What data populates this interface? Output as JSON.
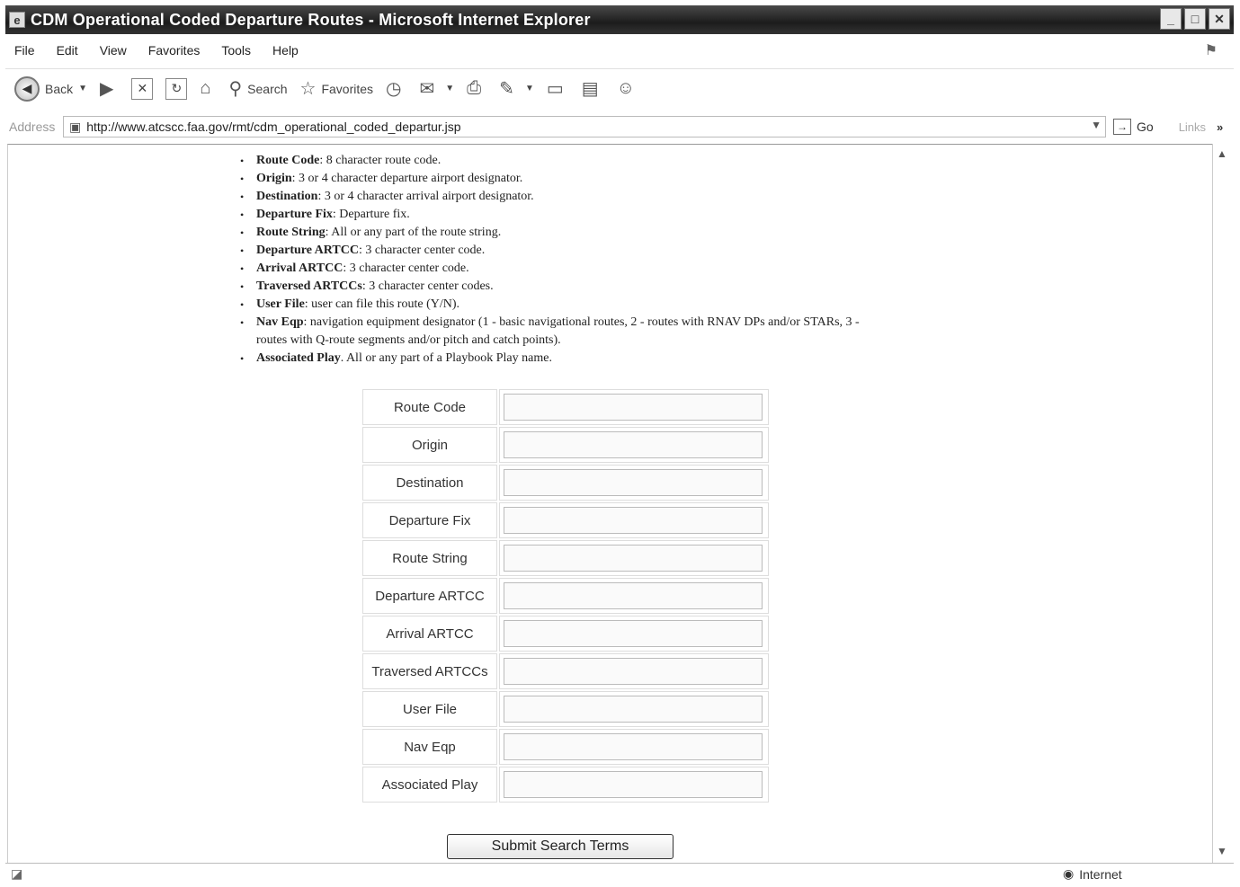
{
  "window": {
    "title": "CDM Operational Coded Departure Routes - Microsoft Internet Explorer"
  },
  "menu": [
    "File",
    "Edit",
    "View",
    "Favorites",
    "Tools",
    "Help"
  ],
  "toolbar": {
    "back_label": "Back",
    "search_label": "Search",
    "favorites_label": "Favorites"
  },
  "address": {
    "label": "Address",
    "url": "http://www.atcscc.faa.gov/rmt/cdm_operational_coded_departur.jsp",
    "go_label": "Go",
    "links_label": "Links"
  },
  "fields_help": [
    {
      "term": "Route Code",
      "desc": ": 8 character route code."
    },
    {
      "term": "Origin",
      "desc": ": 3 or 4 character departure airport designator."
    },
    {
      "term": "Destination",
      "desc": ": 3 or 4 character arrival airport designator."
    },
    {
      "term": "Departure Fix",
      "desc": ": Departure fix."
    },
    {
      "term": "Route String",
      "desc": ": All or any part of the route string."
    },
    {
      "term": "Departure ARTCC",
      "desc": ": 3 character center code."
    },
    {
      "term": "Arrival ARTCC",
      "desc": ": 3 character center code."
    },
    {
      "term": "Traversed ARTCCs",
      "desc": ": 3 character center codes."
    },
    {
      "term": "User File",
      "desc": ": user can file this route (Y/N)."
    },
    {
      "term": "Nav Eqp",
      "desc": ": navigation equipment designator (1 - basic navigational routes, 2 - routes with RNAV DPs and/or STARs, 3 - routes with Q-route segments and/or pitch and catch points)."
    },
    {
      "term": "Associated Play",
      "desc": ". All or any part of a Playbook Play name."
    }
  ],
  "form": {
    "rows": [
      {
        "label": "Route Code",
        "value": ""
      },
      {
        "label": "Origin",
        "value": ""
      },
      {
        "label": "Destination",
        "value": ""
      },
      {
        "label": "Departure Fix",
        "value": ""
      },
      {
        "label": "Route String",
        "value": ""
      },
      {
        "label": "Departure ARTCC",
        "value": ""
      },
      {
        "label": "Arrival ARTCC",
        "value": ""
      },
      {
        "label": "Traversed ARTCCs",
        "value": ""
      },
      {
        "label": "User File",
        "value": ""
      },
      {
        "label": "Nav Eqp",
        "value": ""
      },
      {
        "label": "Associated Play",
        "value": ""
      }
    ],
    "submit_label": "Submit Search Terms"
  },
  "status": {
    "zone": "Internet"
  }
}
